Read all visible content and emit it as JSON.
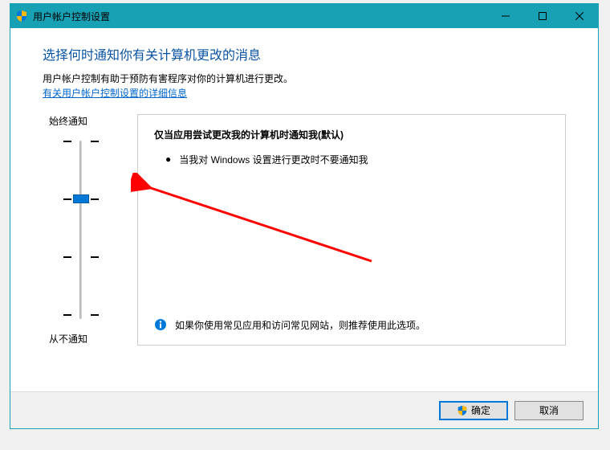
{
  "window": {
    "title": "用户帐户控制设置"
  },
  "heading": "选择何时通知你有关计算机更改的消息",
  "subtext": "用户帐户控制有助于预防有害程序对你的计算机进行更改。",
  "link_text": "有关用户帐户控制设置的详细信息",
  "slider": {
    "top_label": "始终通知",
    "bottom_label": "从不通知",
    "levels": 4,
    "current_level": 1
  },
  "description": {
    "title": "仅当应用尝试更改我的计算机时通知我(默认)",
    "bullet": "当我对 Windows 设置进行更改时不要通知我",
    "footer": "如果你使用常见应用和访问常见网站，则推荐使用此选项。"
  },
  "buttons": {
    "ok": "确定",
    "cancel": "取消"
  }
}
